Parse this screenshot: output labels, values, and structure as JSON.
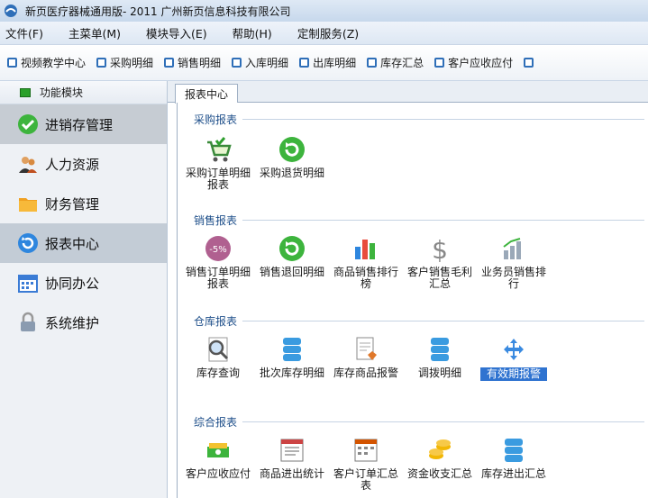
{
  "window": {
    "title": "新页医疗器械通用版- 2011 广州新页信息科技有限公司"
  },
  "menu": [
    "文件(F)",
    "主菜单(M)",
    "模块导入(E)",
    "帮助(H)",
    "定制服务(Z)"
  ],
  "toolbar": [
    "视频教学中心",
    "采购明细",
    "销售明细",
    "入库明细",
    "出库明细",
    "库存汇总",
    "客户应收应付"
  ],
  "sidebar": {
    "header": "功能模块",
    "items": [
      "进销存管理",
      "人力资源",
      "财务管理",
      "报表中心",
      "协同办公",
      "系统维护"
    ]
  },
  "tab": "报表中心",
  "sections": {
    "purchase": {
      "title": "采购报表",
      "items": [
        "采购订单明细报表",
        "采购退货明细"
      ]
    },
    "sales": {
      "title": "销售报表",
      "items": [
        "销售订单明细报表",
        "销售退回明细",
        "商品销售排行榜",
        "客户销售毛利汇总",
        "业务员销售排行"
      ]
    },
    "warehouse": {
      "title": "仓库报表",
      "items": [
        "库存查询",
        "批次库存明细",
        "库存商品报警",
        "调拨明细",
        "有效期报警"
      ]
    },
    "general": {
      "title": "综合报表",
      "items": [
        "客户应收应付",
        "商品进出统计",
        "客户订单汇总表",
        "资金收支汇总",
        "库存进出汇总"
      ]
    }
  },
  "colors": {
    "accent": "#2f73d0",
    "section_title": "#1e4f8a",
    "sidebar_bg": "#eef1f5"
  }
}
